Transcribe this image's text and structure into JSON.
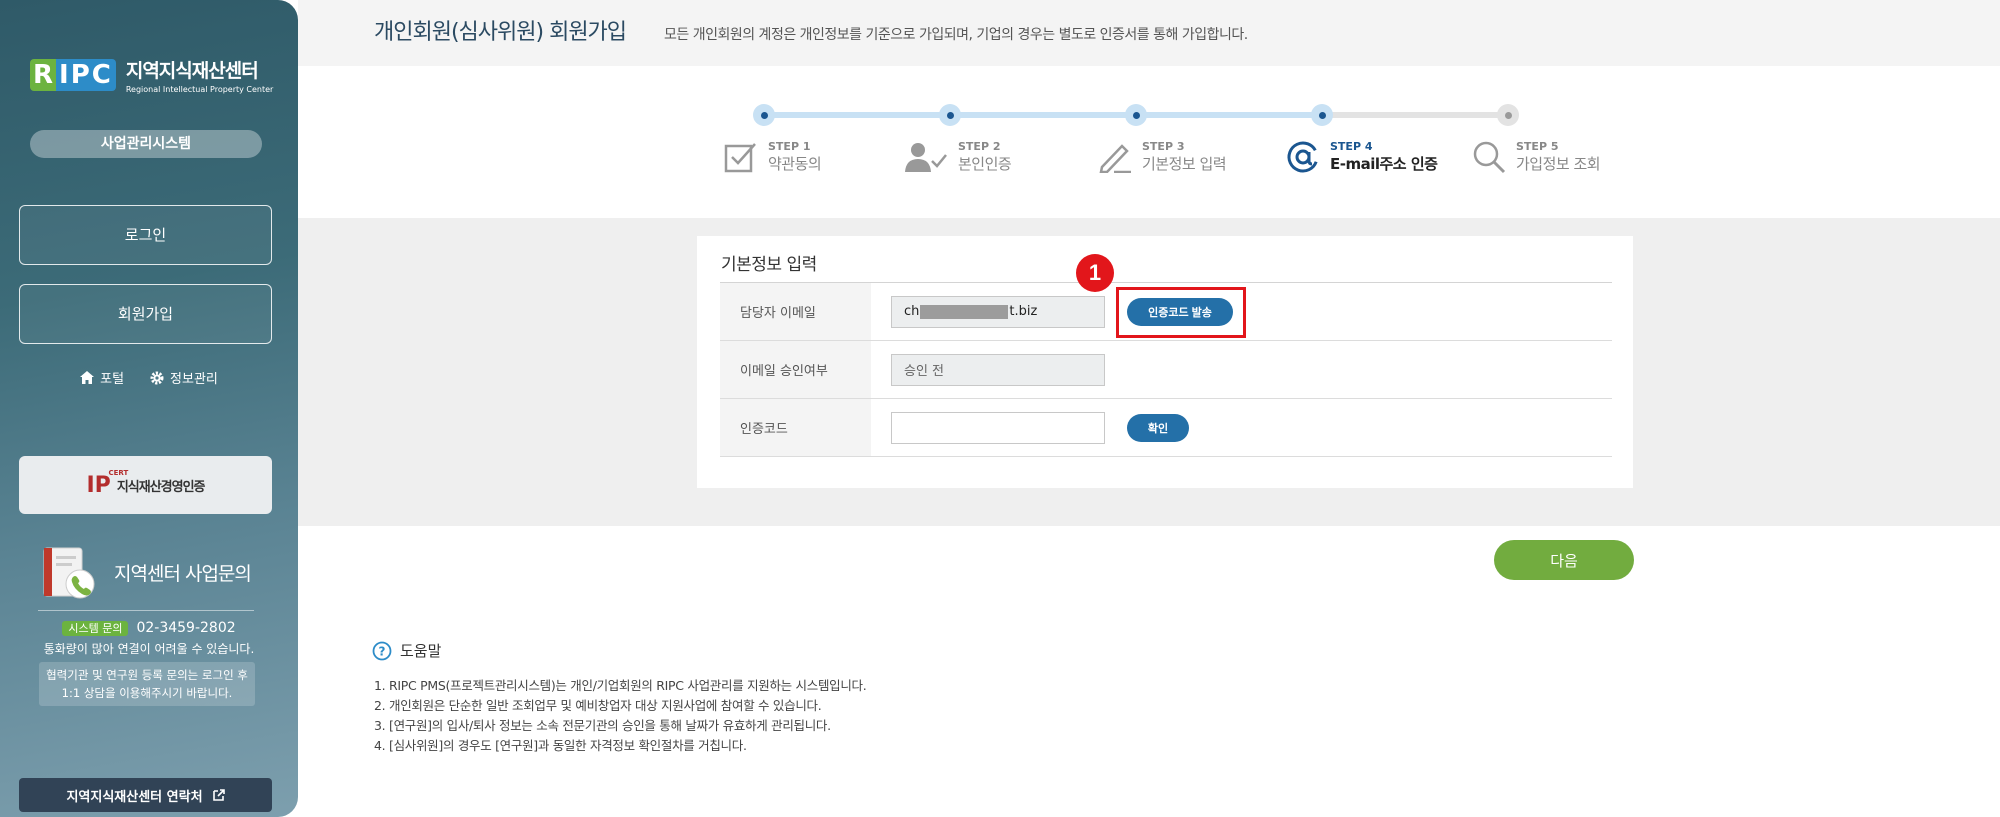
{
  "sidebar": {
    "logo_mark_r": "R",
    "logo_mark_ipc": "IPC",
    "logo_ko": "지역지식재산센터",
    "logo_en": "Regional Intellectual Property Center",
    "system_label": "사업관리시스템",
    "login": "로그인",
    "signup": "회원가입",
    "portal": "포털",
    "info_manage": "정보관리",
    "cert_small": "CERT",
    "cert_logo": "IP",
    "cert_text": "지식재산경영인증",
    "inquiry_title": "지역센터 사업문의",
    "sys_tag": "시스템 문의",
    "sys_phone": "02-3459-2802",
    "sys_note": "통화량이 많아 연결이 어려울 수 있습니다.",
    "sys_box_line1": "협력기관 및 연구원 등록 문의는 로그인 후",
    "sys_box_line2": "1:1 상담을 이용해주시기 바랍니다.",
    "contact": "지역지식재산센터 연락처"
  },
  "header": {
    "title": "개인회원(심사위원) 회원가입",
    "desc": "모든 개인회원의 계정은 개인정보를 기준으로 가입되며, 기업의 경우는 별도로 인증서를 통해 가입합니다."
  },
  "steps": [
    {
      "num": "STEP 1",
      "label": "약관동의",
      "icon": "checkbox-icon"
    },
    {
      "num": "STEP 2",
      "label": "본인인증",
      "icon": "user-check-icon"
    },
    {
      "num": "STEP 3",
      "label": "기본정보 입력",
      "icon": "pencil-icon"
    },
    {
      "num": "STEP 4",
      "label": "E-mail주소 인증",
      "icon": "at-icon"
    },
    {
      "num": "STEP 5",
      "label": "가입정보 조회",
      "icon": "search-icon"
    }
  ],
  "current_step": 4,
  "form": {
    "title": "기본정보 입력",
    "email_label": "담당자 이메일",
    "email_prefix": "ch",
    "email_suffix": "t.biz",
    "send_code": "인증코드 발송",
    "approval_label": "이메일 승인여부",
    "approval_value": "승인 전",
    "code_label": "인증코드",
    "code_value": "",
    "confirm": "확인"
  },
  "annotation_badge": "1",
  "next": "다음",
  "help": {
    "title": "도움말",
    "items": [
      "1. RIPC PMS(프로젝트관리시스템)는 개인/기업회원의 RIPC 사업관리를 지원하는 시스템입니다.",
      "2. 개인회원은 단순한 일반 조회업무 및 예비창업자 대상 지원사업에 참여할 수 있습니다.",
      "3. [연구원]의 입사/퇴사 정보는 소속 전문기관의 승인을 통해 날짜가 유효하게 관리됩니다.",
      "4. [심사위원]의 경우도 [연구원]과 동일한 자격정보 확인절차를 거칩니다."
    ]
  },
  "colors": {
    "accent": "#2470a8",
    "green": "#72ac3f",
    "highlight": "#e2161b"
  }
}
